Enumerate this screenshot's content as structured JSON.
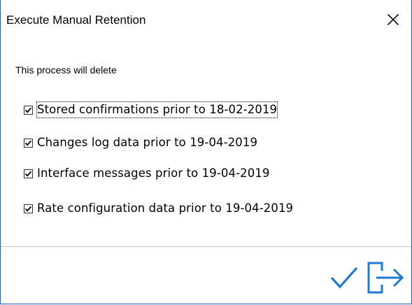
{
  "window": {
    "title": "Execute Manual Retention",
    "close_icon": "close-icon"
  },
  "intro_text": "This process will delete",
  "options": [
    {
      "label": "Stored confirmations prior to 18-02-2019",
      "checked": true,
      "focused": true
    },
    {
      "label": "Changes log data prior to 19-04-2019",
      "checked": true,
      "focused": false
    },
    {
      "label": "Interface messages prior to 19-04-2019",
      "checked": true,
      "focused": false
    },
    {
      "label": "Rate configuration data prior to 19-04-2019",
      "checked": true,
      "focused": false
    }
  ],
  "actions": {
    "ok_icon": "checkmark-icon",
    "exit_icon": "exit-icon"
  },
  "colors": {
    "accent": "#1f7ad6",
    "window_border": "#1f5fbf",
    "text": "#000000",
    "divider": "#c8c8c8"
  }
}
